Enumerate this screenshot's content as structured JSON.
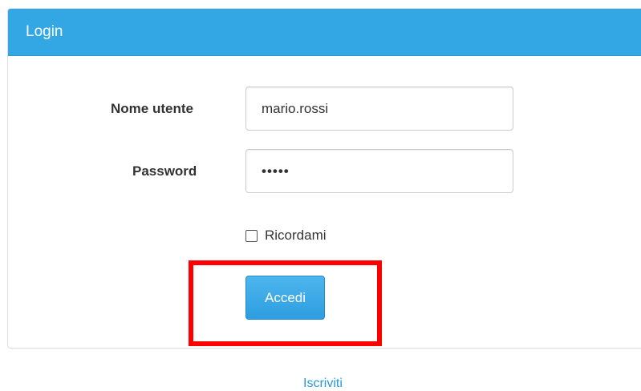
{
  "panel": {
    "title": "Login"
  },
  "form": {
    "username": {
      "label": "Nome utente",
      "value": "mario.rossi"
    },
    "password": {
      "label": "Password",
      "value": "•••••"
    },
    "remember": {
      "label": "Ricordami",
      "checked": false
    },
    "submit_label": "Accedi"
  },
  "footer": {
    "register_label": "Iscriviti"
  },
  "colors": {
    "header_bg": "#33a6e4",
    "button_bg": "#2e9ee0",
    "highlight": "#ff0000",
    "link": "#2a9ad6"
  }
}
